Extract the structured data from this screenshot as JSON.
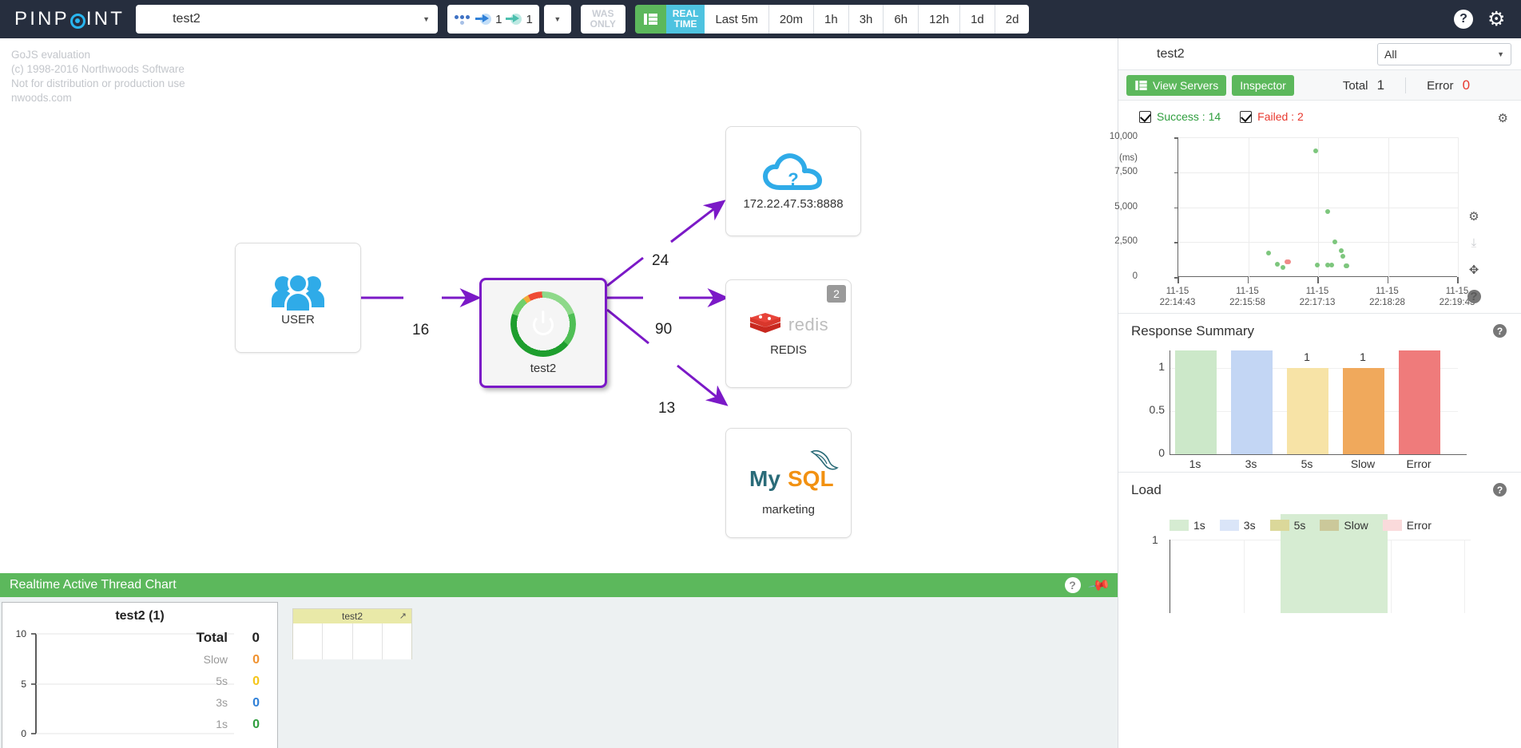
{
  "topnav": {
    "brand": "PINPOINT",
    "app_selected": "test2",
    "app_icon": "springboot-hexagon-icon",
    "node_counter": {
      "inbound": "1",
      "outbound": "1"
    },
    "was_only": {
      "line1": "WAS",
      "line2": "ONLY"
    },
    "grid_button": "grid-icon",
    "realtime": {
      "line1": "REAL",
      "line2": "TIME"
    },
    "periods": [
      "Last 5m",
      "20m",
      "1h",
      "3h",
      "6h",
      "12h",
      "1d",
      "2d"
    ],
    "help_icon": "question-circle-icon",
    "settings_icon": "gear-icon"
  },
  "map": {
    "watermark": [
      "GoJS evaluation",
      "(c) 1998-2016 Northwoods Software",
      "Not for distribution or production use",
      "nwoods.com"
    ],
    "nodes": [
      {
        "id": "user",
        "label": "USER",
        "icon": "users-icon",
        "badge": null
      },
      {
        "id": "test2",
        "label": "test2",
        "icon": "springboot-gauge-icon",
        "badge": null
      },
      {
        "id": "unknown",
        "label": "172.22.47.53:8888",
        "icon": "cloud-question-icon",
        "badge": null
      },
      {
        "id": "redis",
        "label": "REDIS",
        "icon": "redis-logo-icon",
        "badge": "2",
        "logo_text": "redis"
      },
      {
        "id": "mysql",
        "label": "marketing",
        "icon": "mysql-logo-icon",
        "badge": null,
        "logo_my": "My",
        "logo_sql": "SQL"
      }
    ],
    "edges": [
      {
        "from": "user",
        "to": "test2",
        "count": "16"
      },
      {
        "from": "test2",
        "to": "unknown",
        "count": "24"
      },
      {
        "from": "test2",
        "to": "redis",
        "count": "90"
      },
      {
        "from": "test2",
        "to": "mysql",
        "count": "13"
      }
    ]
  },
  "bottom_panel": {
    "title": "Realtime Active Thread Chart",
    "help_icon": "question-circle-icon",
    "pin_icon": "pin-icon",
    "thread_chart": {
      "title": "test2 (1)",
      "y_ticks": [
        "10",
        "5",
        "0"
      ],
      "rows": [
        {
          "label": "Total",
          "value": "0",
          "color": "#222222"
        },
        {
          "label": "Slow",
          "value": "0",
          "color": "#f0922f"
        },
        {
          "label": "5s",
          "value": "0",
          "color": "#f5c518"
        },
        {
          "label": "3s",
          "value": "0",
          "color": "#2f80d8"
        },
        {
          "label": "1s",
          "value": "0",
          "color": "#2f9e3e"
        }
      ]
    },
    "mini_table": {
      "header": "test2",
      "external_icon": "external-link-icon"
    }
  },
  "right_panel": {
    "app_name": "test2",
    "app_icon": "springboot-hexagon-icon",
    "filter_selected": "All",
    "buttons": {
      "view_servers": "View Servers",
      "inspector": "Inspector"
    },
    "totals": [
      {
        "label": "Total",
        "value": "1",
        "color": "#333333"
      },
      {
        "label": "Error",
        "value": "0",
        "color": "#e8392f"
      }
    ],
    "legend": [
      {
        "label": "Success : 14",
        "checked": true,
        "color": "#2f9e3e"
      },
      {
        "label": "Failed : 2",
        "checked": true,
        "color": "#e8392f"
      }
    ],
    "settings_icon": "gear-icon",
    "side_icons": [
      "gear-icon",
      "download-icon",
      "expand-icon",
      "question-circle-icon"
    ],
    "sections": [
      {
        "id": "response_summary",
        "title": "Response Summary",
        "help_icon": "question-circle-icon"
      },
      {
        "id": "load",
        "title": "Load",
        "help_icon": "question-circle-icon"
      }
    ]
  },
  "chart_data": [
    {
      "type": "scatter",
      "id": "response-scatter",
      "title": "",
      "xlabel": "",
      "ylabel": "(ms)",
      "ylim": [
        0,
        10000
      ],
      "y_ticks": [
        "10,000",
        "7,500",
        "5,000",
        "2,500",
        "0"
      ],
      "y_tick_values": [
        10000,
        7500,
        5000,
        2500,
        0
      ],
      "x_ticks": [
        "11-15\n22:14:43",
        "11-15\n22:15:58",
        "11-15\n22:17:13",
        "11-15\n22:18:28",
        "11-15\n22:19:43"
      ],
      "x_tick_lines": [
        [
          "11-15",
          "22:14:43"
        ],
        [
          "11-15",
          "22:15:58"
        ],
        [
          "11-15",
          "22:17:13"
        ],
        [
          "11-15",
          "22:18:28"
        ],
        [
          "11-15",
          "22:19:43"
        ]
      ],
      "grid": true,
      "legend_position": "top",
      "series": [
        {
          "name": "Success",
          "color": "#7dc67d",
          "points": [
            [
              0.322,
              1700
            ],
            [
              0.355,
              930
            ],
            [
              0.375,
              690
            ],
            [
              0.49,
              9050
            ],
            [
              0.498,
              830
            ],
            [
              0.533,
              4700
            ],
            [
              0.535,
              870
            ],
            [
              0.548,
              870
            ],
            [
              0.56,
              2520
            ],
            [
              0.582,
              1870
            ],
            [
              0.588,
              1480
            ],
            [
              0.6,
              800
            ],
            [
              0.603,
              790
            ]
          ]
        },
        {
          "name": "Failed",
          "color": "#ef8a88",
          "points": [
            [
              0.388,
              1080
            ],
            [
              0.393,
              1080
            ]
          ]
        }
      ]
    },
    {
      "type": "bar",
      "id": "response-summary",
      "title": "Response Summary",
      "categories": [
        "1s",
        "3s",
        "5s",
        "Slow",
        "Error"
      ],
      "values": [
        1.2,
        1.2,
        1,
        1,
        1.2
      ],
      "value_labels": [
        "",
        "",
        "1",
        "1",
        ""
      ],
      "colors": [
        "#cce8c9",
        "#c3d6f4",
        "#f7e3a6",
        "#f0a95c",
        "#ef7b7b"
      ],
      "ylim": [
        0,
        1.2
      ],
      "y_ticks": [
        "1",
        "0.5",
        "0"
      ],
      "xlabel": "",
      "ylabel": "",
      "grid": true,
      "legend_position": "none"
    },
    {
      "type": "area",
      "id": "load",
      "title": "Load",
      "legend_position": "top",
      "legend": [
        {
          "label": "1s",
          "color": "#d6ecd2"
        },
        {
          "label": "3s",
          "color": "#dae5f8"
        },
        {
          "label": "5s",
          "color": "#dbd89a"
        },
        {
          "label": "Slow",
          "color": "#cbc89a"
        },
        {
          "label": "Error",
          "color": "#fadadb"
        }
      ],
      "y_ticks": [
        "1"
      ],
      "ylim": [
        0,
        1
      ],
      "series": [
        {
          "name": "1s",
          "color": "#d6ecd2",
          "values": [
            0,
            0,
            1,
            1,
            0,
            0
          ]
        }
      ],
      "grid": true
    }
  ]
}
